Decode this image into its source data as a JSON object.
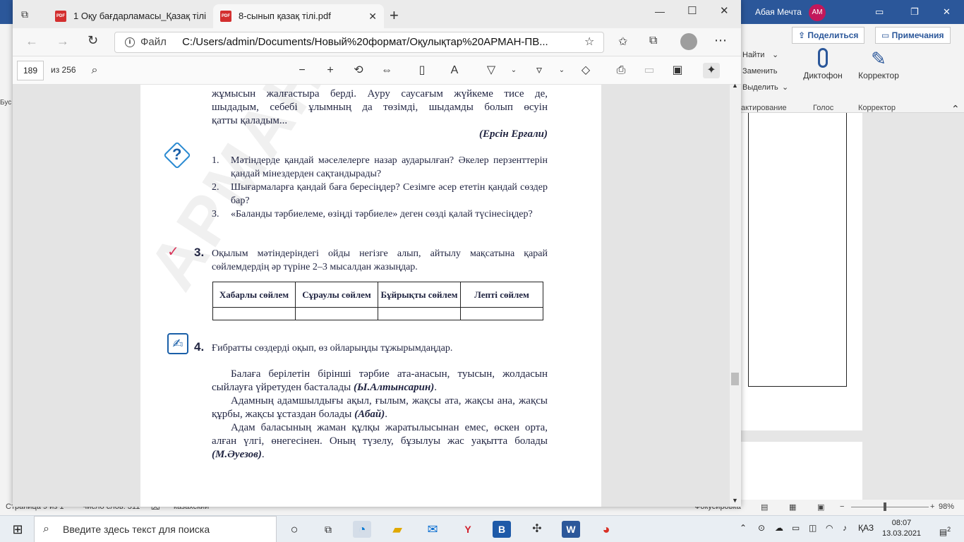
{
  "word": {
    "user_name": "Абая Мечта",
    "user_initials": "АМ",
    "share_label": "Поделиться",
    "notes_label": "Примечания",
    "find_label": "Найти",
    "replace_label": "Заменить",
    "select_label": "Выделить",
    "group_editing": "актирование",
    "dictate_label": "Диктофон",
    "group_voice": "Голос",
    "editor_label": "Корректор",
    "group_editor": "Корректор",
    "left_strip": "Бус",
    "status_page": "Страница 9 из 1",
    "status_words": "Число слов: 311",
    "status_lang": "казахский",
    "status_focus": "Фокусировка",
    "zoom": "98%"
  },
  "browser": {
    "tabs": [
      {
        "label": "1 Оқу бағдарламасы_Қазақ тілі"
      },
      {
        "label": "8-сынып қазақ тілі.pdf"
      }
    ],
    "address": {
      "file_label": "Файл",
      "path": "C:/Users/admin/Documents/Новый%20формат/Оқулықтар%20АРМАН-ПВ..."
    },
    "pdf": {
      "page_current": "189",
      "page_of": "из 256"
    }
  },
  "pdf_page": {
    "intro_lines": [
      "жұмысын жалғастыра берді. Ауру саусағым жүйкеме тисе де,",
      "шыдадым, себебі ұлымның да төзімді, шыдамды болып өсуін",
      "қатты қаладым..."
    ],
    "intro_author": "(Ерсін Ерғали)",
    "questions": [
      {
        "num": "1.",
        "text": "Мәтіндерде қандай мәселелерге назар аударылған? Әкелер перзенттерін қандай мінездерден сақтандырады?"
      },
      {
        "num": "2.",
        "text": "Шығармаларға қандай баға бересіңдер? Сезімге әсер ететін қандай сөздер бар?"
      },
      {
        "num": "3.",
        "text": "«Баланды тәрбиелеме, өзіңді тәрбиеле» деген сөзді қалай түсінесіңдер?"
      }
    ],
    "task3_num": "3.",
    "task3_text": "Оқылым мәтіндеріндегі ойды негізге алып, айтылу мақсатына қарай сөйлемдердің әр түріне 2–3 мысалдан жазыңдар.",
    "table_headers": [
      "Хабарлы сөйлем",
      "Сұраулы сөйлем",
      "Бұйрықты сөйлем",
      "Лепті сөйлем"
    ],
    "task4_num": "4.",
    "task4_text": "Ғибратты сөздерді оқып, өз ойларыңды тұжырымдаңдар.",
    "quotes": [
      {
        "text": "Балаға берілетін бірінші тәрбие ата-анасын, туысын, жолдасын сыйлауға үйретуден басталады ",
        "author": "(Ы.Алтынсарин)",
        "end": "."
      },
      {
        "text": "Адамның адамшылдығы ақыл, ғылым, жақсы ата, жақсы ана, жақсы құрбы, жақсы ұстаздан болады ",
        "author": "(Абай)",
        "end": "."
      },
      {
        "text": "Адам баласының жаман құлқы жаратылысынан емес, өскен орта, алған үлгі, өнегесінен. Оның түзелу, бұзылуы жас уақытта болады ",
        "author": "(М.Әуезов)",
        "end": "."
      }
    ],
    "watermark": "АРМАН-ПВ баспасы"
  },
  "taskbar": {
    "search_placeholder": "Введите здесь текст для поиска",
    "lang": "ҚАЗ",
    "time": "08:07",
    "date": "13.03.2021",
    "notifications": "2"
  }
}
